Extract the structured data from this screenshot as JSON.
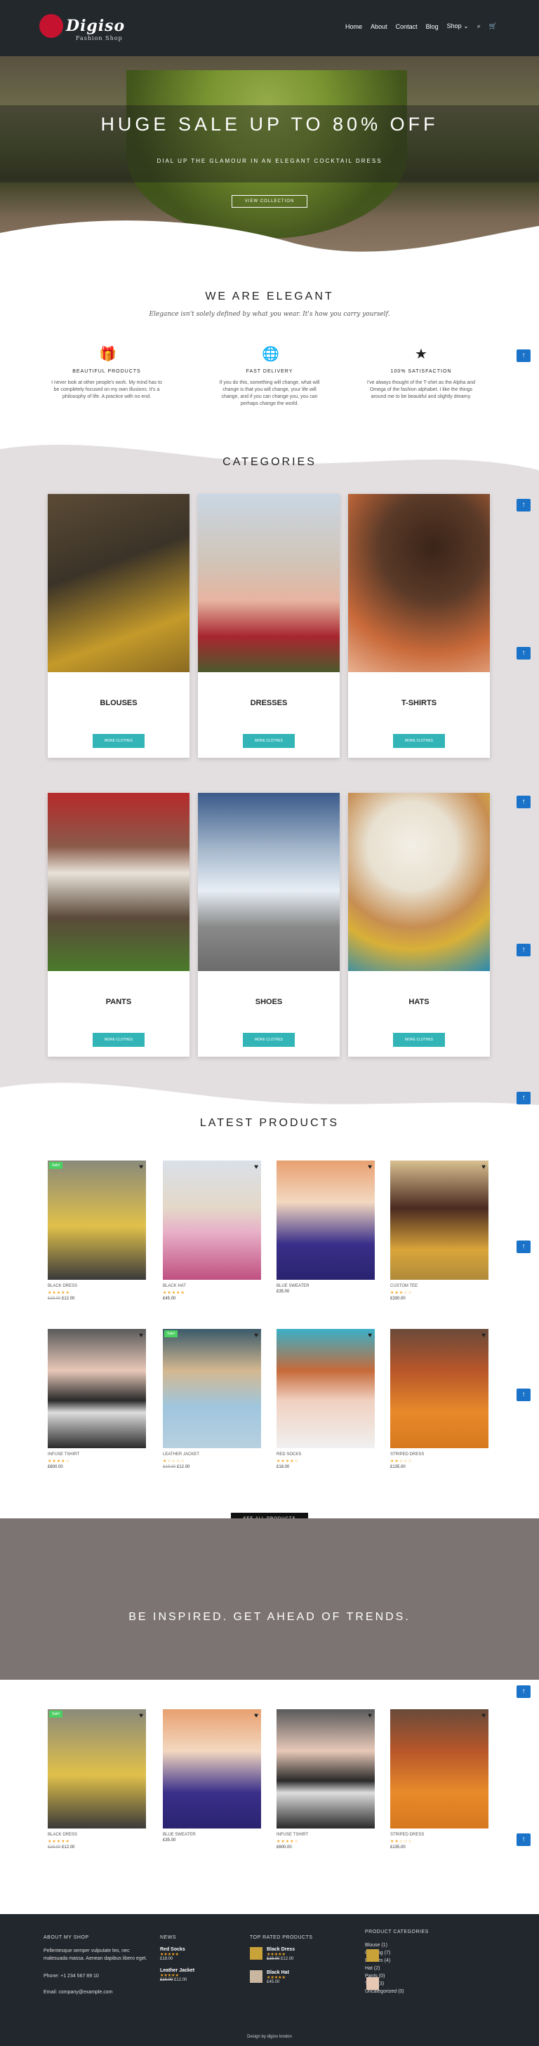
{
  "header": {
    "logo_main": "Digiso",
    "logo_sub": "Fashion Shop",
    "nav": [
      "Home",
      "About",
      "Contact",
      "Blog",
      "Shop"
    ]
  },
  "hero": {
    "title": "HUGE SALE UP TO 80% OFF",
    "subtitle": "DIAL UP THE GLAMOUR IN AN ELEGANT COCKTAIL DRESS",
    "button": "VIEW COLLECTION"
  },
  "elegant": {
    "title": "WE ARE ELEGANT",
    "subtitle": "Elegance isn't solely defined by what you wear. It's how you carry yourself.",
    "features": [
      {
        "icon": "gift-icon",
        "title": "BEAUTIFUL PRODUCTS",
        "text": "I never look at other people's work. My mind has to be completely focused on my own illusions. It's a philosophy of life. A practice with no end."
      },
      {
        "icon": "globe-icon",
        "title": "FAST DELIVERY",
        "text": "If you do this, something will change, what will change is that you will change, your life will change, and if you can change you, you can perhaps change the world."
      },
      {
        "icon": "star-icon",
        "title": "100% SATISFACTION",
        "text": "I've always thought of the T-shirt as the Alpha and Omega of the fashion alphabet. I like the things around me to be beautiful and slightly dreamy."
      }
    ]
  },
  "categories": {
    "title": "CATEGORIES",
    "button": "MORE CLOTHES",
    "items": [
      "BLOUSES",
      "DRESSES",
      "T-SHIRTS",
      "PANTS",
      "SHOES",
      "HATS"
    ]
  },
  "latest": {
    "title": "LATEST PRODUCTS",
    "button": "SEE ALL PRODUCTS",
    "items": [
      {
        "name": "BLACK DRESS",
        "old": "£19.00",
        "price": "£12.00",
        "sale": true,
        "rating": 5
      },
      {
        "name": "BLACK HAT",
        "old": "",
        "price": "£45.00",
        "sale": false,
        "rating": 5
      },
      {
        "name": "BLUE SWEATER",
        "old": "",
        "price": "£35.00",
        "sale": false,
        "rating": 0
      },
      {
        "name": "CUSTOM TEE",
        "old": "",
        "price": "£330.00",
        "sale": false,
        "rating": 3
      },
      {
        "name": "INFUSE TSHIRT",
        "old": "",
        "price": "£600.00",
        "sale": false,
        "rating": 4
      },
      {
        "name": "LEATHER JACKET",
        "old": "£19.00",
        "price": "£12.00",
        "sale": true,
        "rating": 1
      },
      {
        "name": "RED SOCKS",
        "old": "",
        "price": "£18.00",
        "sale": false,
        "rating": 4
      },
      {
        "name": "STRIPED DRESS",
        "old": "",
        "price": "£135.00",
        "sale": false,
        "rating": 2
      }
    ]
  },
  "inspired": {
    "title": "BE INSPIRED. GET AHEAD OF TRENDS."
  },
  "featured": {
    "items": [
      {
        "name": "BLACK DRESS",
        "old": "£19.00",
        "price": "£12.00",
        "sale": true,
        "rating": 5
      },
      {
        "name": "BLUE SWEATER",
        "old": "",
        "price": "£35.00",
        "sale": false,
        "rating": 0
      },
      {
        "name": "INFUSE TSHIRT",
        "old": "",
        "price": "£600.00",
        "sale": false,
        "rating": 4
      },
      {
        "name": "STRIPED DRESS",
        "old": "",
        "price": "£135.00",
        "sale": false,
        "rating": 2
      }
    ]
  },
  "footer": {
    "about_title": "ABOUT MY SHOP",
    "about_text": "Pellentesque semper vulputate leo, nec malesuada massa. Aenean dapibus libero eget.",
    "phone": "Phone: +1 234 567 89 10",
    "email": "Email: company@example.com",
    "news_title": "NEWS",
    "news": [
      {
        "title": "Red Socks",
        "price": "£18.00"
      },
      {
        "title": "Leather Jacket",
        "old": "£19.00",
        "price": "£12.00"
      }
    ],
    "top_title": "TOP RATED PRODUCTS",
    "top": [
      {
        "title": "Black Dress",
        "old": "£19.00",
        "price": "£12.00"
      },
      {
        "title": "Black Hat",
        "price": "£45.00"
      }
    ],
    "cats_title": "PRODUCT CATEGORIES",
    "cats": [
      "Blouse (1)",
      "Clothing (7)",
      "Dresses (4)",
      "Hat (2)",
      "Pants (0)",
      "Tshirt (3)",
      "Uncategorized (0)"
    ],
    "credit": "Design by digiso london"
  },
  "colors": {
    "accent": "#33b5b8",
    "header": "#23282d",
    "sale": "#4ccf63",
    "star": "#f5a623",
    "up": "#1a73c8"
  }
}
